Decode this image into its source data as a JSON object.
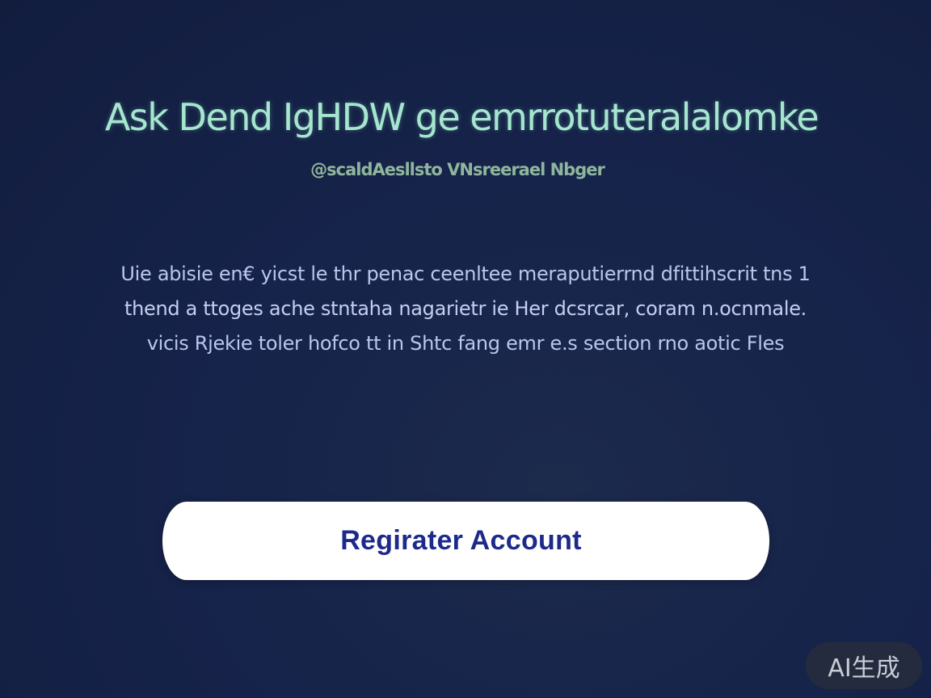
{
  "hero": {
    "title": "Ask Dend IgHDW ge emrrotuteralalomke",
    "subtitle": "@scaldAesllsto VNsreerael Nbger"
  },
  "description": {
    "lines": [
      "Uie abisie en€ yicst le thr penac ceenltee meraputierrnd dfittihscrit tns 1",
      "thend a ttoges ache stntaha nagarietr ie Her dcsrcar, coram n.ocnmale.",
      "vicis Rjekie toler hofco tt in Shtc fang emr e.s section rno aotic Fles"
    ]
  },
  "cta": {
    "label": "Regirater Account"
  },
  "badge": {
    "label": "AI生成"
  },
  "colors": {
    "background": "#15214a",
    "title": "#a6e6cf",
    "subtitle": "#8fb69c",
    "body_text": "#b9c7ee",
    "button_bg": "#ffffff",
    "button_text": "#1d2a8c"
  }
}
